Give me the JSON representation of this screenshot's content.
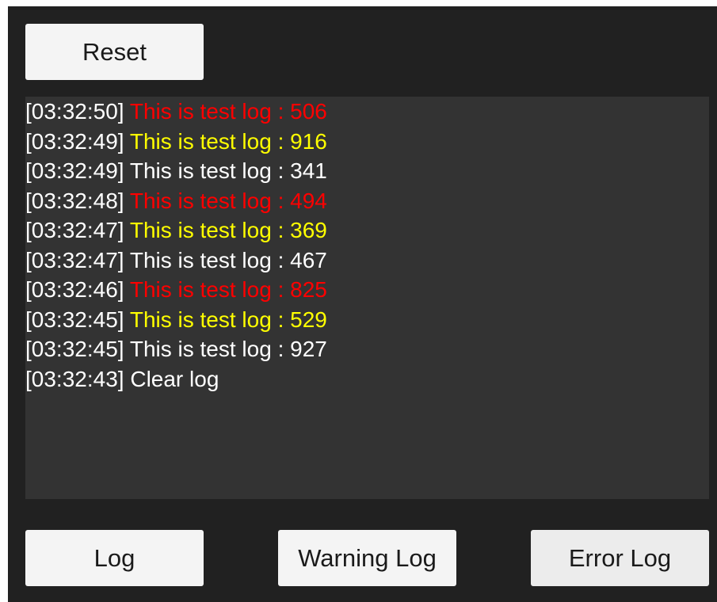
{
  "colors": {
    "info": "#ffffff",
    "warning": "#ffff00",
    "error": "#ff0000",
    "panel_background": "#212121",
    "log_background": "#333333",
    "button_background": "#f4f4f4"
  },
  "buttons": {
    "reset": "Reset",
    "log": "Log",
    "warning_log": "Warning Log",
    "error_log": "Error Log"
  },
  "log_entries": [
    {
      "time": "[03:32:50]",
      "message": "This is test log : 506",
      "level": "error"
    },
    {
      "time": "[03:32:49]",
      "message": "This is test log : 916",
      "level": "warning"
    },
    {
      "time": "[03:32:49]",
      "message": "This is test log : 341",
      "level": "info"
    },
    {
      "time": "[03:32:48]",
      "message": "This is test log : 494",
      "level": "error"
    },
    {
      "time": "[03:32:47]",
      "message": "This is test log : 369",
      "level": "warning"
    },
    {
      "time": "[03:32:47]",
      "message": "This is test log : 467",
      "level": "info"
    },
    {
      "time": "[03:32:46]",
      "message": "This is test log : 825",
      "level": "error"
    },
    {
      "time": "[03:32:45]",
      "message": "This is test log : 529",
      "level": "warning"
    },
    {
      "time": "[03:32:45]",
      "message": "This is test log : 927",
      "level": "info"
    },
    {
      "time": "[03:32:43]",
      "message": "Clear log",
      "level": "info"
    }
  ]
}
